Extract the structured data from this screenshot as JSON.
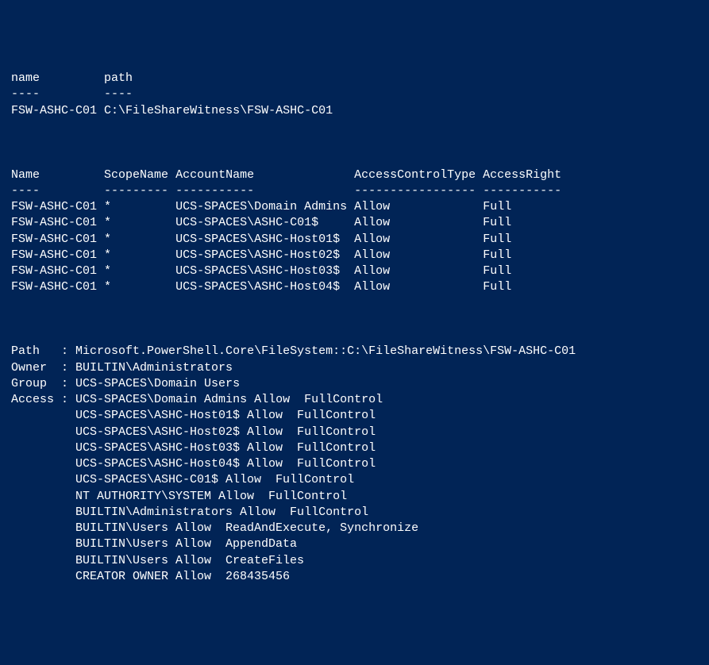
{
  "table1": {
    "headers": {
      "name": "name",
      "path": "path"
    },
    "dashes": {
      "name": "----",
      "path": "----"
    },
    "rows": [
      {
        "name": "FSW-ASHC-C01",
        "path": "C:\\FileShareWitness\\FSW-ASHC-C01"
      }
    ]
  },
  "table2": {
    "headers": {
      "name": "Name",
      "scope": "ScopeName",
      "account": "AccountName",
      "access": "AccessControlType",
      "right": "AccessRight"
    },
    "dashes": {
      "name": "----",
      "scope": "---------",
      "account": "-----------",
      "access": "-----------------",
      "right": "-----------"
    },
    "rows": [
      {
        "name": "FSW-ASHC-C01",
        "scope": "*",
        "account": "UCS-SPACES\\Domain Admins",
        "access": "Allow",
        "right": "Full"
      },
      {
        "name": "FSW-ASHC-C01",
        "scope": "*",
        "account": "UCS-SPACES\\ASHC-C01$",
        "access": "Allow",
        "right": "Full"
      },
      {
        "name": "FSW-ASHC-C01",
        "scope": "*",
        "account": "UCS-SPACES\\ASHC-Host01$",
        "access": "Allow",
        "right": "Full"
      },
      {
        "name": "FSW-ASHC-C01",
        "scope": "*",
        "account": "UCS-SPACES\\ASHC-Host02$",
        "access": "Allow",
        "right": "Full"
      },
      {
        "name": "FSW-ASHC-C01",
        "scope": "*",
        "account": "UCS-SPACES\\ASHC-Host03$",
        "access": "Allow",
        "right": "Full"
      },
      {
        "name": "FSW-ASHC-C01",
        "scope": "*",
        "account": "UCS-SPACES\\ASHC-Host04$",
        "access": "Allow",
        "right": "Full"
      }
    ]
  },
  "details": {
    "path": {
      "label": "Path",
      "value": "Microsoft.PowerShell.Core\\FileSystem::C:\\FileShareWitness\\FSW-ASHC-C01"
    },
    "owner": {
      "label": "Owner",
      "value": "BUILTIN\\Administrators"
    },
    "group": {
      "label": "Group",
      "value": "UCS-SPACES\\Domain Users"
    },
    "access_label": "Access",
    "access": [
      "UCS-SPACES\\Domain Admins Allow  FullControl",
      "UCS-SPACES\\ASHC-Host01$ Allow  FullControl",
      "UCS-SPACES\\ASHC-Host02$ Allow  FullControl",
      "UCS-SPACES\\ASHC-Host03$ Allow  FullControl",
      "UCS-SPACES\\ASHC-Host04$ Allow  FullControl",
      "UCS-SPACES\\ASHC-C01$ Allow  FullControl",
      "NT AUTHORITY\\SYSTEM Allow  FullControl",
      "BUILTIN\\Administrators Allow  FullControl",
      "BUILTIN\\Users Allow  ReadAndExecute, Synchronize",
      "BUILTIN\\Users Allow  AppendData",
      "BUILTIN\\Users Allow  CreateFiles",
      "CREATOR OWNER Allow  268435456"
    ]
  }
}
